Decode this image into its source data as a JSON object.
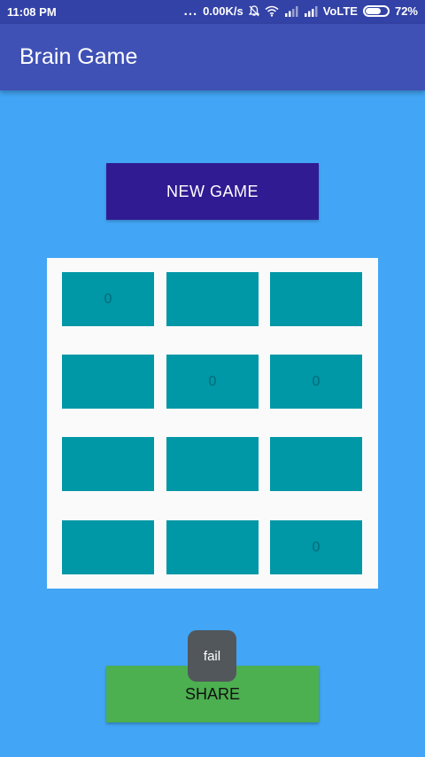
{
  "status_bar": {
    "time": "11:08 PM",
    "dots": "...",
    "net_speed": "0.00K/s",
    "carrier": "VoLTE",
    "battery": "72%",
    "battery_level": 0.72,
    "icons": [
      "bell-off-icon",
      "wifi-icon",
      "signal-icon",
      "signal-icon",
      "battery-icon"
    ]
  },
  "app_bar": {
    "title": "Brain Game"
  },
  "buttons": {
    "new_game": "NEW GAME",
    "share": "SHARE"
  },
  "board": {
    "tiles": [
      {
        "label": "0"
      },
      {
        "label": ""
      },
      {
        "label": ""
      },
      {
        "label": ""
      },
      {
        "label": "0"
      },
      {
        "label": "0"
      },
      {
        "label": ""
      },
      {
        "label": ""
      },
      {
        "label": ""
      },
      {
        "label": ""
      },
      {
        "label": ""
      },
      {
        "label": "0"
      }
    ]
  },
  "toast": {
    "message": "fail"
  },
  "colors": {
    "background": "#42a5f5",
    "status_bar": "#3342a6",
    "app_bar": "#3f51b5",
    "new_game_button": "#311b92",
    "tile": "#0097a7",
    "share_button": "#4caf50",
    "toast": "#52575c"
  }
}
